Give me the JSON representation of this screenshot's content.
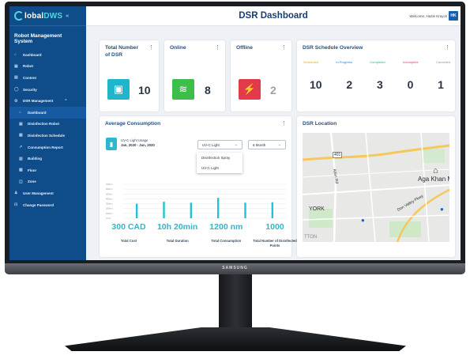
{
  "app": {
    "logo_main": "lobal",
    "logo_accent": "DWS",
    "collapse_glyph": "«",
    "system_title": "Robot Management System"
  },
  "header": {
    "title": "DSR Dashboard",
    "welcome": "Welcome, Hazle Krayck",
    "avatar_initials": "HK"
  },
  "sidebar": {
    "items": [
      {
        "label": "Dashboard",
        "icon": "home-icon",
        "glyph": "⌂"
      },
      {
        "label": "Robot",
        "icon": "robot-icon",
        "glyph": "▣"
      },
      {
        "label": "Content",
        "icon": "content-icon",
        "glyph": "▤"
      },
      {
        "label": "Security",
        "icon": "shield-icon",
        "glyph": "◯"
      },
      {
        "label": "DSR Management",
        "icon": "gear-icon",
        "glyph": "⚙"
      },
      {
        "label": "Dashboard",
        "icon": "home-icon",
        "glyph": "⌂"
      },
      {
        "label": "Disinfection Robot",
        "icon": "robot-icon",
        "glyph": "▣"
      },
      {
        "label": "Disinfection Schedule",
        "icon": "calendar-icon",
        "glyph": "▦"
      },
      {
        "label": "Consumption Report",
        "icon": "chart-icon",
        "glyph": "↗"
      },
      {
        "label": "Building",
        "icon": "building-icon",
        "glyph": "▥"
      },
      {
        "label": "Floor",
        "icon": "floor-icon",
        "glyph": "▩"
      },
      {
        "label": "Zone",
        "icon": "zone-icon",
        "glyph": "◫"
      },
      {
        "label": "User Management",
        "icon": "user-icon",
        "glyph": "♟"
      },
      {
        "label": "Change Password",
        "icon": "lock-icon",
        "glyph": "⊡"
      }
    ]
  },
  "cards": {
    "total": {
      "title_line1": "Total Number",
      "title_line2": "of DSR",
      "value": "10",
      "color": "#1fb6cc"
    },
    "online": {
      "title": "Online",
      "value": "8",
      "color": "#3cbf4a"
    },
    "offline": {
      "title": "Offline",
      "value": "2",
      "color": "#e23a4a"
    },
    "schedule": {
      "title": "DSR Schedule Overview",
      "items": [
        {
          "label": "Scheduled",
          "value": "10",
          "color": "#e7a51a"
        },
        {
          "label": "In Progress",
          "value": "2",
          "color": "#2d7fd6"
        },
        {
          "label": "Completed",
          "value": "3",
          "color": "#2bb673"
        },
        {
          "label": "Incomplete",
          "value": "0",
          "color": "#e23a6a"
        },
        {
          "label": "Cancelled",
          "value": "1",
          "color": "#8a94a2"
        }
      ]
    },
    "consumption": {
      "title": "Average Consumption",
      "usage_label": "UV-C Light Usage",
      "date_range": "Jan, 2020 - Jun, 2020",
      "type_select": "UV-C Light",
      "period_select": "6 Month",
      "dropdown_options": [
        "Disinfection Spray",
        "UV-C Light"
      ],
      "stats": [
        {
          "value": "300 CAD",
          "label": "Total Cost"
        },
        {
          "value": "10h 20min",
          "label": "Total Duration"
        },
        {
          "value": "1200 nm",
          "label": "Total Consumption"
        },
        {
          "value": "1000",
          "label": "Total Number of Disinfected Points"
        }
      ]
    },
    "location": {
      "title": "DSR Location",
      "map_labels": {
        "highway": "401",
        "road1": "Allen Rd",
        "place1": "Aga Khan Mu",
        "place2": "YORK",
        "road2": "Don Valley Pkwy",
        "edge": "TTON"
      }
    }
  },
  "chart_data": {
    "type": "bar",
    "categories": [
      "Jan",
      "Feb",
      "Mar",
      "Apr",
      "May",
      "June"
    ],
    "values": [
      300,
      340,
      320,
      420,
      320,
      330
    ],
    "ylim": [
      0,
      700
    ],
    "ytick_labels": [
      "700nm",
      "600nm",
      "500nm",
      "400nm",
      "300nm",
      "200nm",
      "100nm",
      "0 nm"
    ],
    "grid": true,
    "color": "#1fc3d6"
  },
  "monitor": {
    "brand": "SAMSUNG"
  }
}
